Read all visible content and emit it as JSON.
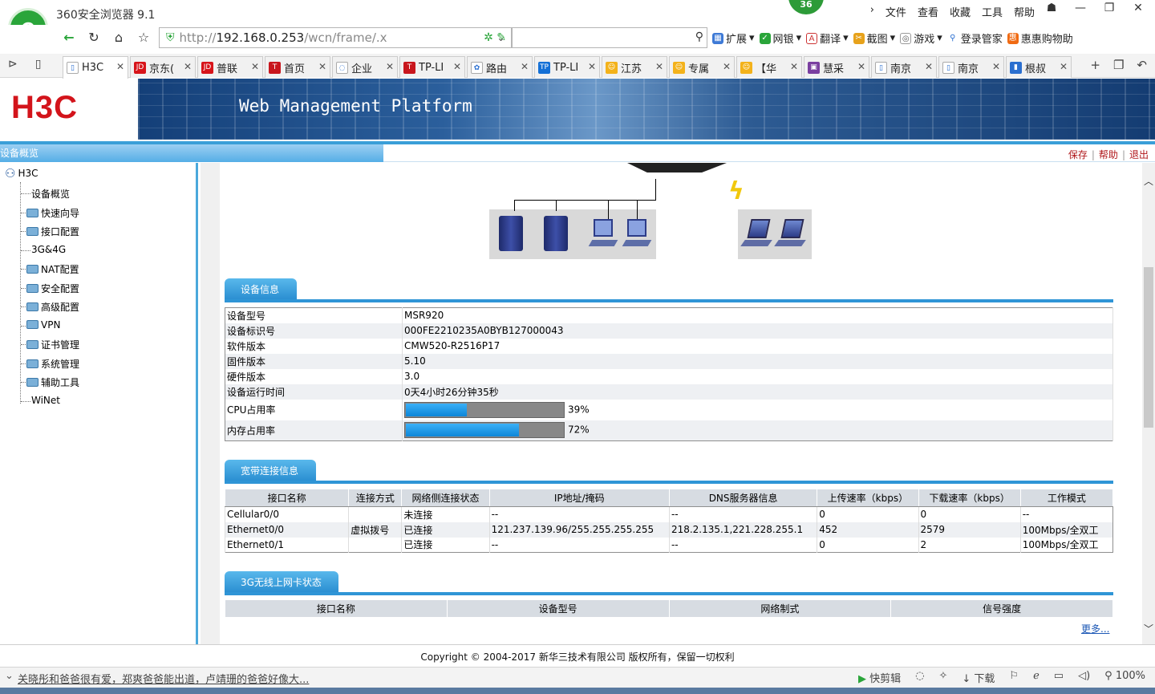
{
  "browser": {
    "title": "360安全浏览器 9.1",
    "badge": "36",
    "menus": [
      "文件",
      "查看",
      "收藏",
      "工具",
      "帮助"
    ],
    "address_gray": "http://",
    "address_host": "192.168.0.253",
    "address_path": "/wcn/frame/.x",
    "toolbar": [
      "扩展",
      "网银",
      "翻译",
      "截图",
      "游戏",
      "登录管家",
      "惠惠购物助"
    ],
    "tabs": [
      {
        "label": "H3C",
        "icon": "document-icon"
      },
      {
        "label": "京东(",
        "icon": "jd-icon"
      },
      {
        "label": "普联",
        "icon": "jd-icon"
      },
      {
        "label": "首页",
        "icon": "t-icon"
      },
      {
        "label": "企业",
        "icon": "loading-icon"
      },
      {
        "label": "TP-LI",
        "icon": "t-icon"
      },
      {
        "label": "路由",
        "icon": "baidu-paw-icon"
      },
      {
        "label": "TP-LI",
        "icon": "tp-icon"
      },
      {
        "label": "江苏",
        "icon": "emoji-icon"
      },
      {
        "label": "专属",
        "icon": "emoji-icon"
      },
      {
        "label": "【华",
        "icon": "emoji-icon"
      },
      {
        "label": "慧采",
        "icon": "box-icon"
      },
      {
        "label": "南京",
        "icon": "document-icon"
      },
      {
        "label": "南京",
        "icon": "document-icon"
      },
      {
        "label": "根叔",
        "icon": "blue-icon"
      }
    ]
  },
  "app": {
    "brand": "H3C",
    "banner_title": "Web Management Platform",
    "section_title": "设备概览",
    "links": [
      "保存",
      "帮助",
      "退出"
    ]
  },
  "tree": {
    "root": "H3C",
    "items": [
      "设备概览",
      "快速向导",
      "接口配置",
      "3G&4G",
      "NAT配置",
      "安全配置",
      "高级配置",
      "VPN",
      "证书管理",
      "系统管理",
      "辅助工具",
      "WiNet"
    ]
  },
  "device_info": {
    "title": "设备信息",
    "rows": [
      {
        "k": "设备型号",
        "v": "MSR920"
      },
      {
        "k": "设备标识号",
        "v": "000FE2210235A0BYB127000043"
      },
      {
        "k": "软件版本",
        "v": "CMW520-R2516P17"
      },
      {
        "k": "固件版本",
        "v": "5.10"
      },
      {
        "k": "硬件版本",
        "v": "3.0"
      },
      {
        "k": "设备运行时间",
        "v": "0天4小时26分钟35秒"
      }
    ],
    "cpu_label": "CPU占用率",
    "cpu": 39,
    "cpu_text": "39%",
    "mem_label": "内存占用率",
    "mem": 72,
    "mem_text": "72%"
  },
  "broadband": {
    "title": "宽带连接信息",
    "headers": [
      "接口名称",
      "连接方式",
      "网络侧连接状态",
      "IP地址/掩码",
      "DNS服务器信息",
      "上传速率（kbps）",
      "下载速率（kbps）",
      "工作模式"
    ],
    "rows": [
      [
        "Cellular0/0",
        "",
        "未连接",
        "--",
        "--",
        "0",
        "0",
        "--"
      ],
      [
        "Ethernet0/0",
        "虚拟拨号",
        "已连接",
        "121.237.139.96/255.255.255.255",
        "218.2.135.1,221.228.255.1",
        "452",
        "2579",
        "100Mbps/全双工"
      ],
      [
        "Ethernet0/1",
        "",
        "已连接",
        "--",
        "--",
        "0",
        "2",
        "100Mbps/全双工"
      ]
    ]
  },
  "g3": {
    "title": "3G无线上网卡状态",
    "headers": [
      "接口名称",
      "设备型号",
      "网络制式",
      "信号强度"
    ],
    "more": "更多..."
  },
  "footer": "Copyright © 2004-2017 新华三技术有限公司 版权所有，保留一切权利",
  "statusbar": {
    "ticker": "关晓彤和爸爸很有爱，郑爽爸爸能出道，卢靖珊的爸爸好像大...",
    "quick_cut": "快剪辑",
    "download": "下载",
    "zoom": "100%"
  }
}
